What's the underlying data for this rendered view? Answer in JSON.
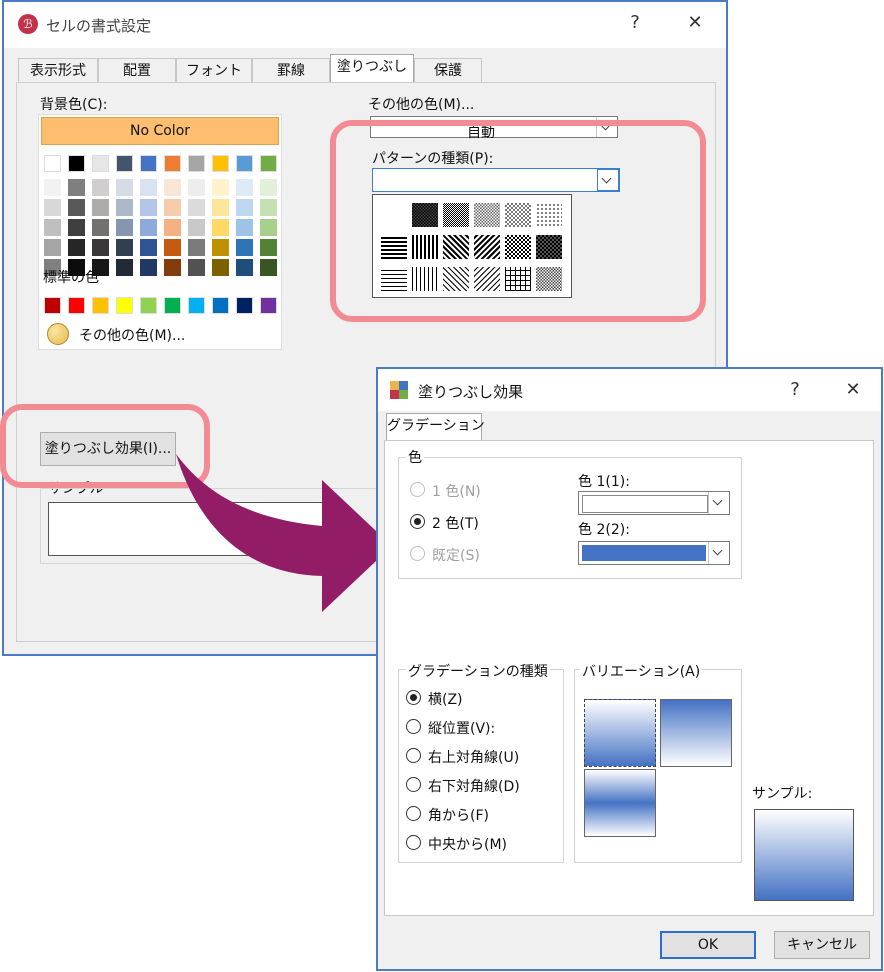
{
  "format_dialog": {
    "title": "セルの書式設定",
    "help": "?",
    "close": "✕",
    "tabs": [
      "表示形式",
      "配置",
      "フォント",
      "罫線",
      "塗りつぶし",
      "保護"
    ],
    "active_tab": "塗りつぶし",
    "background_color_label": "背景色(C):",
    "no_color": "No Color",
    "standard_colors_label": "標準の色",
    "more_colors_link": "その他の色(M)...",
    "pattern_color_label": "その他の色(M)...",
    "pattern_color_value": "自動",
    "pattern_style_label": "パターンの種類(P):",
    "fill_effects_button": "塗りつぶし効果(I)...",
    "sample_label": "サンプル",
    "theme_colors": [
      "#ffffff",
      "#000000",
      "#e7e6e6",
      "#44546a",
      "#4472c4",
      "#ed7d31",
      "#a5a5a5",
      "#ffc000",
      "#5b9bd5",
      "#70ad47"
    ],
    "theme_tints": [
      [
        "#f2f2f2",
        "#7f7f7f",
        "#d0cece",
        "#d6dce4",
        "#d9e2f3",
        "#fbe5d5",
        "#ededed",
        "#fff2cc",
        "#deebf6",
        "#e2efd9"
      ],
      [
        "#d8d8d8",
        "#595959",
        "#aeabab",
        "#adb9ca",
        "#b4c6e7",
        "#f7cbac",
        "#dbdbdb",
        "#fee599",
        "#bdd7ee",
        "#c5e0b3"
      ],
      [
        "#bfbfbf",
        "#3f3f3f",
        "#757070",
        "#8496b0",
        "#8eaadb",
        "#f4b183",
        "#c9c9c9",
        "#ffd965",
        "#9dc3e6",
        "#a8d08d"
      ],
      [
        "#a5a5a5",
        "#262626",
        "#3a3838",
        "#323f4f",
        "#2f5496",
        "#c55a11",
        "#7b7b7b",
        "#bf9000",
        "#2e75b5",
        "#538135"
      ],
      [
        "#7f7f7f",
        "#0c0c0c",
        "#171616",
        "#222a35",
        "#1f3864",
        "#833c0b",
        "#525252",
        "#7f6000",
        "#1e4e79",
        "#375623"
      ]
    ],
    "standard_colors": [
      "#c00000",
      "#ff0000",
      "#ffc000",
      "#ffff00",
      "#92d050",
      "#00b050",
      "#00b0f0",
      "#0070c0",
      "#002060",
      "#7030a0"
    ]
  },
  "fill_effects_dialog": {
    "title": "塗りつぶし効果",
    "help": "?",
    "close": "✕",
    "tab": "グラデーション",
    "colors_group": "色",
    "options": [
      {
        "label": "1 色(N)",
        "state": "disabled"
      },
      {
        "label": "2 色(T)",
        "state": "selected"
      },
      {
        "label": "既定(S)",
        "state": "disabled"
      }
    ],
    "color1_label": "色 1(1):",
    "color2_label": "色 2(2):",
    "color1_value": "#ffffff",
    "color2_value": "#4472c4",
    "shading_group": "グラデーションの種類",
    "shading_styles": [
      "横(Z)",
      "縦位置(V):",
      "右上対角線(U)",
      "右下対角線(D)",
      "角から(F)",
      "中央から(M)"
    ],
    "selected_shading": "横(Z)",
    "variants_group": "バリエーション(A)",
    "sample_label": "サンプル:",
    "ok": "OK",
    "cancel": "キャンセル"
  }
}
